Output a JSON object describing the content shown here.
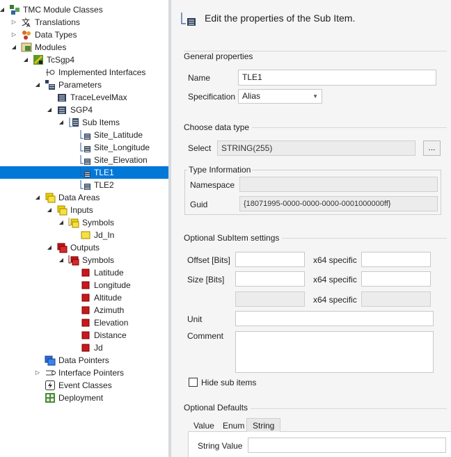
{
  "tree": {
    "rows": [
      {
        "label": "TMC Module Classes",
        "icon": "module-classes-icon",
        "twisty": "expanded",
        "selected": false
      },
      {
        "label": "Translations",
        "icon": "translations-icon",
        "twisty": "collapsed",
        "selected": false
      },
      {
        "label": "Data Types",
        "icon": "data-types-icon",
        "twisty": "collapsed",
        "selected": false
      },
      {
        "label": "Modules",
        "icon": "modules-icon",
        "twisty": "expanded",
        "selected": false
      },
      {
        "label": "TcSgp4",
        "icon": "module-icon",
        "twisty": "expanded",
        "selected": false
      },
      {
        "label": "Implemented Interfaces",
        "icon": "interfaces-icon",
        "twisty": "none",
        "selected": false
      },
      {
        "label": "Parameters",
        "icon": "parameters-icon",
        "twisty": "expanded",
        "selected": false
      },
      {
        "label": "TraceLevelMax",
        "icon": "parameter-icon",
        "twisty": "none",
        "selected": false
      },
      {
        "label": "SGP4",
        "icon": "parameter-icon",
        "twisty": "expanded",
        "selected": false
      },
      {
        "label": "Sub Items",
        "icon": "sub-items-icon",
        "twisty": "expanded",
        "selected": false
      },
      {
        "label": "Site_Latitude",
        "icon": "sub-item-icon",
        "twisty": "none",
        "selected": false
      },
      {
        "label": "Site_Longitude",
        "icon": "sub-item-icon",
        "twisty": "none",
        "selected": false
      },
      {
        "label": "Site_Elevation",
        "icon": "sub-item-icon",
        "twisty": "none",
        "selected": false
      },
      {
        "label": "TLE1",
        "icon": "sub-item-icon",
        "twisty": "none",
        "selected": true
      },
      {
        "label": "TLE2",
        "icon": "sub-item-icon",
        "twisty": "none",
        "selected": false
      },
      {
        "label": "Data Areas",
        "icon": "data-areas-icon",
        "twisty": "expanded",
        "selected": false
      },
      {
        "label": "Inputs",
        "icon": "inputs-icon",
        "twisty": "expanded",
        "selected": false
      },
      {
        "label": "Symbols",
        "icon": "input-symbols-icon",
        "twisty": "expanded",
        "selected": false
      },
      {
        "label": "Jd_In",
        "icon": "input-symbol-icon",
        "twisty": "none",
        "selected": false
      },
      {
        "label": "Outputs",
        "icon": "outputs-icon",
        "twisty": "expanded",
        "selected": false
      },
      {
        "label": "Symbols",
        "icon": "output-symbols-icon",
        "twisty": "expanded",
        "selected": false
      },
      {
        "label": "Latitude",
        "icon": "output-symbol-icon",
        "twisty": "none",
        "selected": false
      },
      {
        "label": "Longitude",
        "icon": "output-symbol-icon",
        "twisty": "none",
        "selected": false
      },
      {
        "label": "Altitude",
        "icon": "output-symbol-icon",
        "twisty": "none",
        "selected": false
      },
      {
        "label": "Azimuth",
        "icon": "output-symbol-icon",
        "twisty": "none",
        "selected": false
      },
      {
        "label": "Elevation",
        "icon": "output-symbol-icon",
        "twisty": "none",
        "selected": false
      },
      {
        "label": "Distance",
        "icon": "output-symbol-icon",
        "twisty": "none",
        "selected": false
      },
      {
        "label": "Jd",
        "icon": "output-symbol-icon",
        "twisty": "none",
        "selected": false
      },
      {
        "label": "Data Pointers",
        "icon": "data-pointers-icon",
        "twisty": "none",
        "selected": false
      },
      {
        "label": "Interface Pointers",
        "icon": "interface-pointers-icon",
        "twisty": "collapsed",
        "selected": false
      },
      {
        "label": "Event Classes",
        "icon": "event-classes-icon",
        "twisty": "none",
        "selected": false
      },
      {
        "label": "Deployment",
        "icon": "deployment-icon",
        "twisty": "none",
        "selected": false
      }
    ]
  },
  "header": {
    "title": "Edit the properties of the Sub Item.",
    "icon": "sub-item-editor-icon"
  },
  "general": {
    "heading": "General properties",
    "name_label": "Name",
    "name_value": "TLE1",
    "spec_label": "Specification",
    "spec_value": "Alias"
  },
  "datatype": {
    "heading": "Choose data type",
    "select_label": "Select",
    "select_value": "STRING(255)",
    "browse_label": "...",
    "type_info_heading": "Type Information",
    "namespace_label": "Namespace",
    "namespace_value": "",
    "guid_label": "Guid",
    "guid_value": "{18071995-0000-0000-0000-0001000000ff}"
  },
  "subitem": {
    "heading": "Optional SubItem settings",
    "offset_label": "Offset [Bits]",
    "offset_value": "",
    "x64_label": "x64 specific",
    "size_label": "Size [Bits]",
    "size_value": "",
    "unit_label": "Unit",
    "unit_value": "",
    "comment_label": "Comment",
    "comment_value": "",
    "hide_label": "Hide sub items",
    "hide_checked": false
  },
  "defaults": {
    "heading": "Optional Defaults",
    "tabs": [
      "Value",
      "Enum",
      "String"
    ],
    "active_tab": "String",
    "string_label": "String Value",
    "string_value": ""
  },
  "colors": {
    "selection": "#0078d7",
    "panel_bg": "#f5f5f5",
    "splitter": "#d6d9de"
  }
}
